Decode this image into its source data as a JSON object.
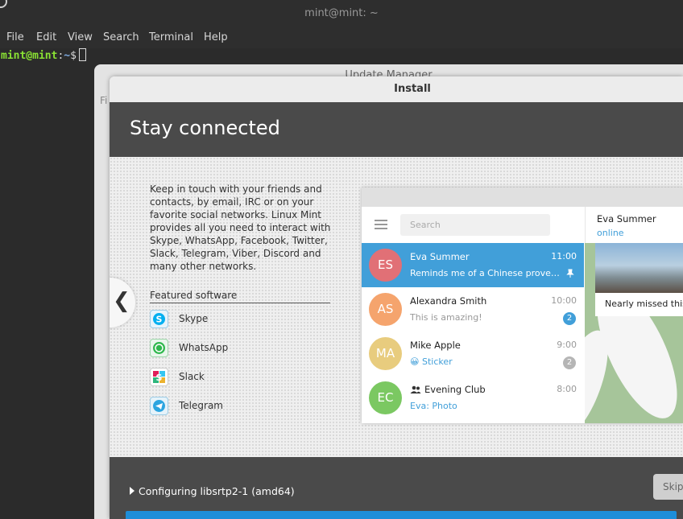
{
  "terminal": {
    "title": "mint@mint: ~",
    "menu": [
      "File",
      "Edit",
      "View",
      "Search",
      "Terminal",
      "Help"
    ],
    "prompt_user": "mint@mint",
    "prompt_sep": ":",
    "prompt_path": "~",
    "prompt_symbol": "$"
  },
  "update_manager": {
    "title": "Update Manager",
    "menu_partial": "Fi"
  },
  "install": {
    "title": "Install",
    "heading": "Stay connected",
    "description": "Keep in touch with your friends and contacts, by email, IRC or on your favorite social networks. Linux Mint provides all you need to interact with Skype, WhatsApp, Facebook, Twitter, Slack, Telegram, Viber, Discord and many other networks.",
    "prev_glyph": "❮",
    "featured_title": "Featured software",
    "featured": [
      {
        "label": "Skype",
        "icon": "skype-icon",
        "color": "#00aff0",
        "glyph": "S"
      },
      {
        "label": "WhatsApp",
        "icon": "whatsapp-icon",
        "color": "#2fb84d",
        "glyph": "✆"
      },
      {
        "label": "Slack",
        "icon": "slack-icon",
        "color": "#4a154b",
        "glyph": "S"
      },
      {
        "label": "Telegram",
        "icon": "telegram-icon",
        "color": "#2ca5e0",
        "glyph": "➤"
      }
    ],
    "status": "Configuring libsrtp2-1 (amd64)",
    "skip_label": "Skip",
    "progress_percent": 100,
    "accent": "#1e8ed9"
  },
  "telegram": {
    "search_placeholder": "Search",
    "chats": [
      {
        "initials": "ES",
        "name": "Eva Summer",
        "message": "Reminds me of a Chinese prover…",
        "time": "11:00",
        "color": "#e17076",
        "active": true,
        "pinned": true
      },
      {
        "initials": "AS",
        "name": "Alexandra Smith",
        "message": "This is amazing!",
        "time": "10:00",
        "color": "#f5a46d",
        "badge": "2",
        "badge_color": "#419fd9"
      },
      {
        "initials": "MA",
        "name": "Mike Apple",
        "message": "Sticker",
        "emoji": "😀",
        "time": "9:00",
        "color": "#e8cc7e",
        "badge": "2",
        "badge_color": "#b5b5b5"
      },
      {
        "initials": "EC",
        "name": "Evening Club",
        "message": "Eva: Photo",
        "time": "8:00",
        "color": "#7bc862",
        "group": true
      }
    ],
    "conversation": {
      "name": "Eva Summer",
      "status": "online",
      "caption": "Nearly missed this"
    }
  }
}
